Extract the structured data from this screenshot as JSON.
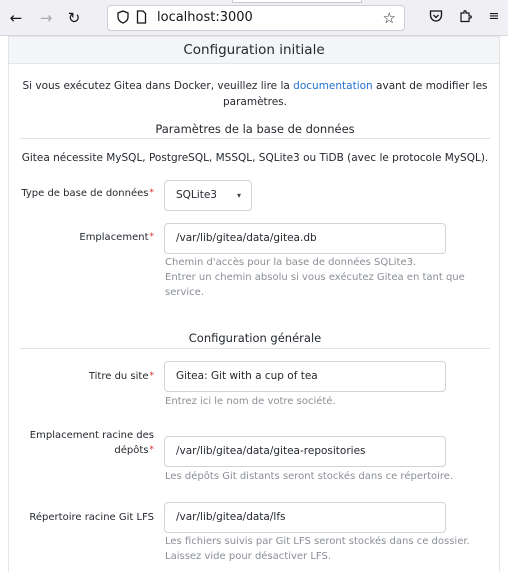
{
  "browser": {
    "url": "localhost:3000"
  },
  "header": {
    "title": "Configuration initiale"
  },
  "notice": {
    "before": "Si vous exécutez Gitea dans Docker, veuillez lire la ",
    "link": "documentation",
    "after": " avant de modifier les paramètres."
  },
  "database": {
    "section_title": "Paramètres de la base de données",
    "requirement": "Gitea nécessite MySQL, PostgreSQL, MSSQL, SQLite3 ou TiDB (avec le protocole MySQL).",
    "type_label": "Type de base de données",
    "type_value": "SQLite3",
    "path_label": "Emplacement",
    "path_value": "/var/lib/gitea/data/gitea.db",
    "path_help_1": "Chemin d'accès pour la base de données SQLite3.",
    "path_help_2": "Entrer un chemin absolu si vous exécutez Gitea en tant que service."
  },
  "general": {
    "section_title": "Configuration générale",
    "site_title_label": "Titre du site",
    "site_title_value": "Gitea: Git with a cup of tea",
    "site_title_help": "Entrez ici le nom de votre société.",
    "repo_root_label_1": "Emplacement racine des",
    "repo_root_label_2": "dépôts",
    "repo_root_value": "/var/lib/gitea/data/gitea-repositories",
    "repo_root_help": "Les dépôts Git distants seront stockés dans ce répertoire.",
    "lfs_root_label": "Répertoire racine Git LFS",
    "lfs_root_value": "/var/lib/gitea/data/lfs",
    "lfs_root_help_1": "Les fichiers suivis par Git LFS seront stockés dans ce dossier.",
    "lfs_root_help_2": "Laissez vide pour désactiver LFS."
  },
  "required_mark": "*"
}
